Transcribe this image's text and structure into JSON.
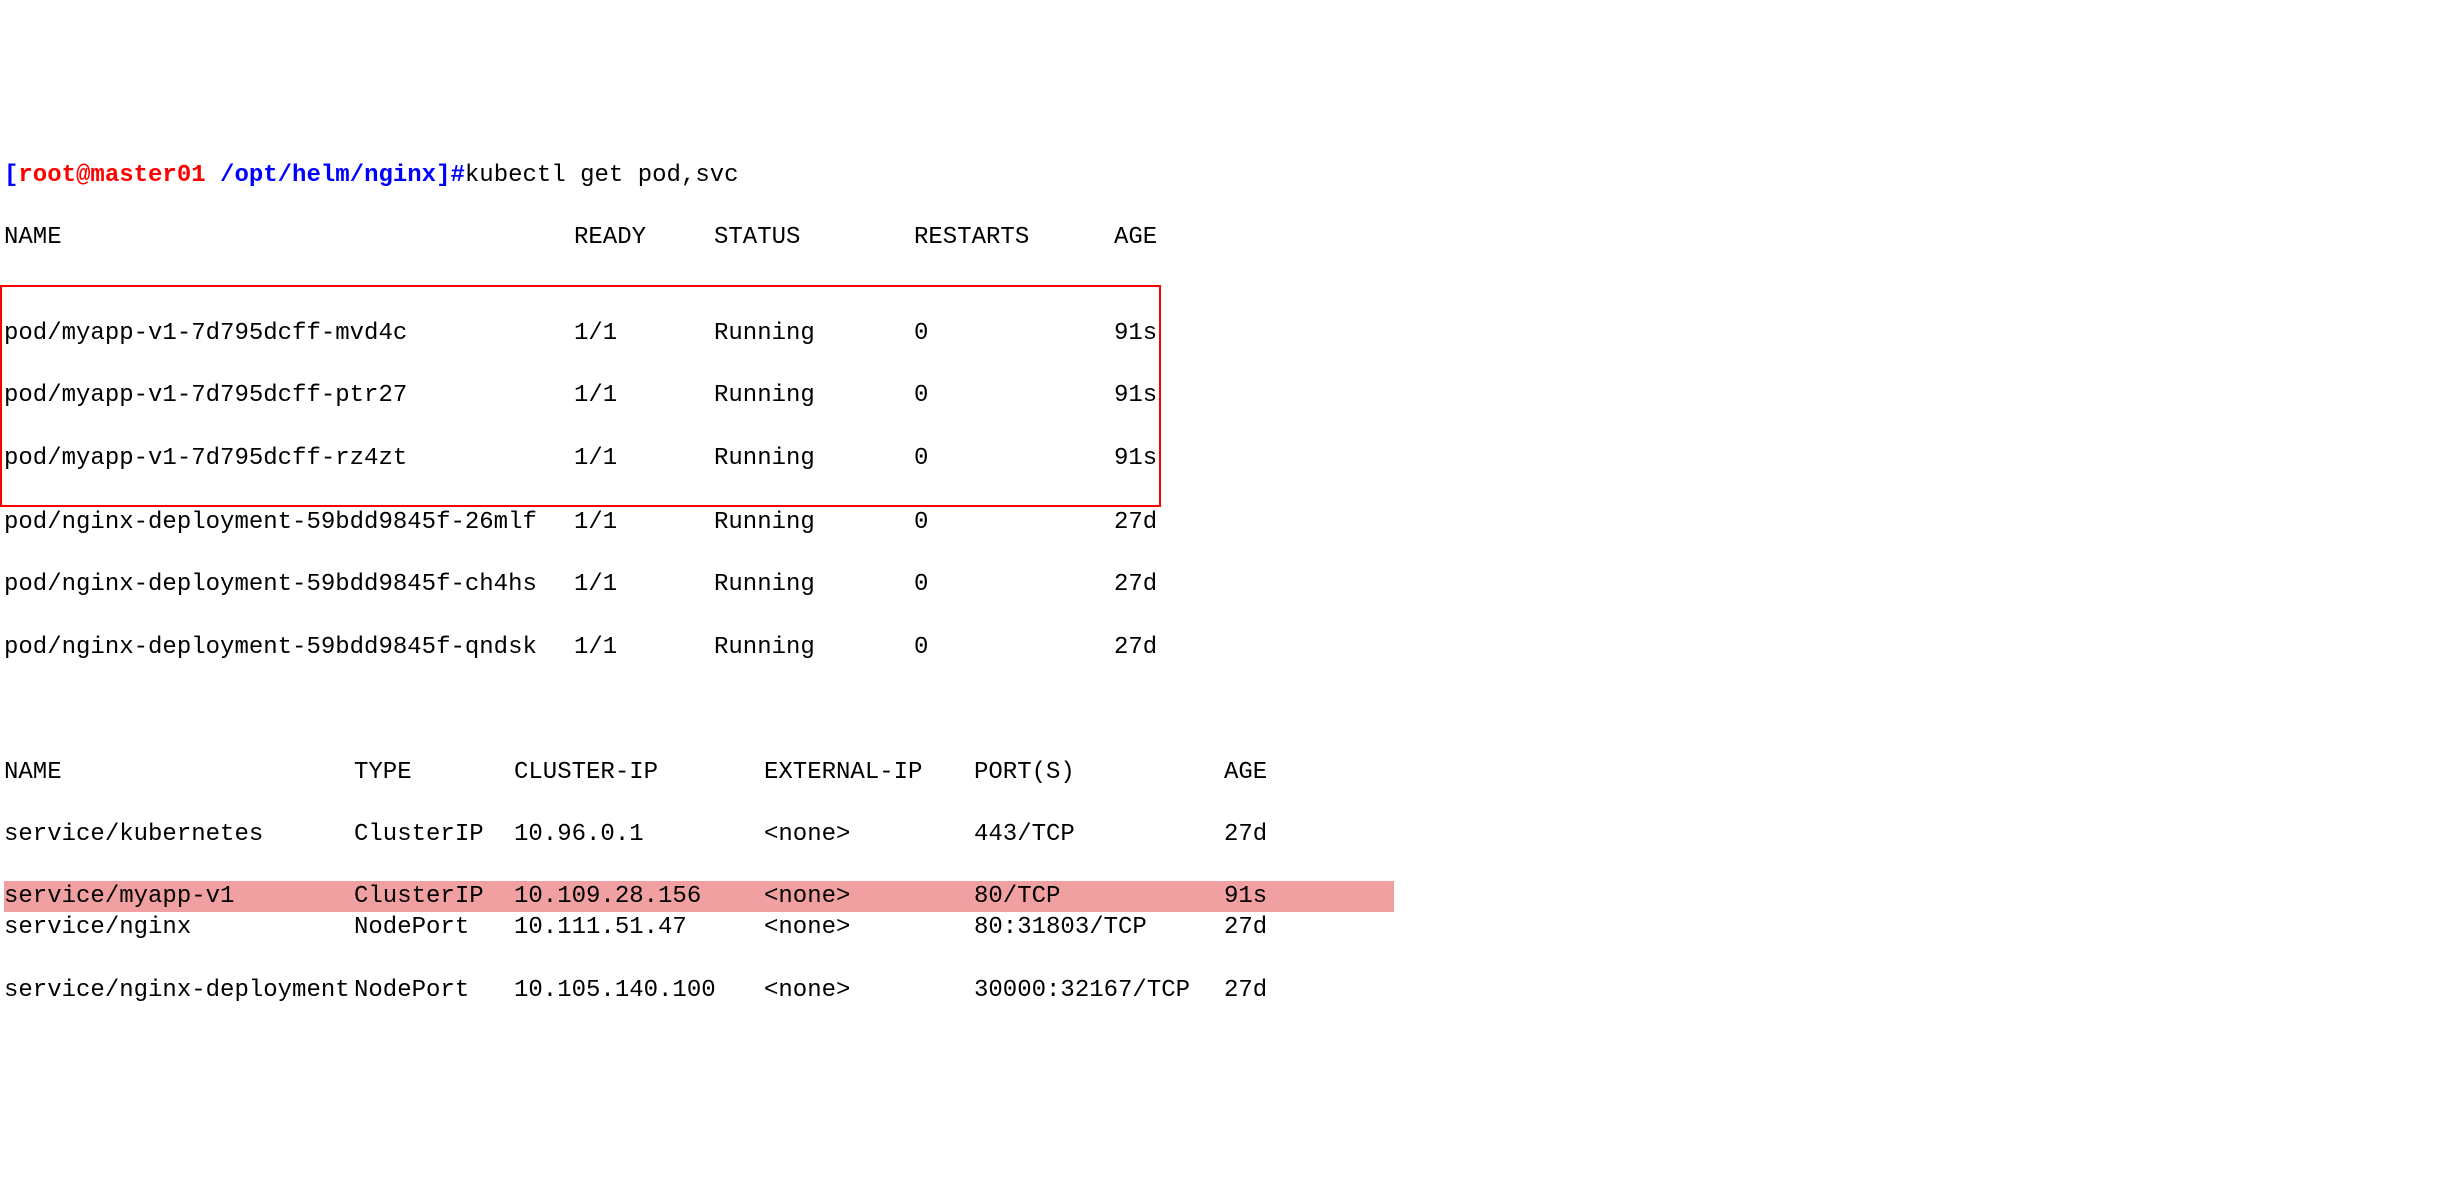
{
  "prompt": {
    "open_bracket": "[",
    "user_host": "root@master01 ",
    "path": "/opt/helm/nginx",
    "close_bracket": "]#",
    "command": "kubectl get pod,svc"
  },
  "pod_header": {
    "name": "NAME",
    "ready": "READY",
    "status": "STATUS",
    "restarts": "RESTARTS",
    "age": "AGE"
  },
  "boxed_pods": [
    {
      "name": "pod/myapp-v1-7d795dcff-mvd4c",
      "ready": "1/1",
      "status": "Running",
      "restarts": "0",
      "age": "91s"
    },
    {
      "name": "pod/myapp-v1-7d795dcff-ptr27",
      "ready": "1/1",
      "status": "Running",
      "restarts": "0",
      "age": "91s"
    },
    {
      "name": "pod/myapp-v1-7d795dcff-rz4zt",
      "ready": "1/1",
      "status": "Running",
      "restarts": "0",
      "age": "91s"
    }
  ],
  "other_pods": [
    {
      "name": "pod/nginx-deployment-59bdd9845f-26mlf",
      "ready": "1/1",
      "status": "Running",
      "restarts": "0",
      "age": "27d"
    },
    {
      "name": "pod/nginx-deployment-59bdd9845f-ch4hs",
      "ready": "1/1",
      "status": "Running",
      "restarts": "0",
      "age": "27d"
    },
    {
      "name": "pod/nginx-deployment-59bdd9845f-qndsk",
      "ready": "1/1",
      "status": "Running",
      "restarts": "0",
      "age": "27d"
    }
  ],
  "svc_header": {
    "name": "NAME",
    "type": "TYPE",
    "cluster_ip": "CLUSTER-IP",
    "external_ip": "EXTERNAL-IP",
    "ports": "PORT(S)",
    "age": "AGE"
  },
  "services_before": [
    {
      "name": "service/kubernetes",
      "type": "ClusterIP",
      "cluster_ip": "10.96.0.1",
      "external_ip": "<none>",
      "ports": "443/TCP",
      "age": "27d"
    }
  ],
  "highlighted_service": {
    "name": "service/myapp-v1",
    "type": "ClusterIP",
    "cluster_ip": "10.109.28.156",
    "external_ip": "<none>",
    "ports": "80/TCP",
    "age": "91s"
  },
  "services_after": [
    {
      "name": "service/nginx",
      "type": "NodePort",
      "cluster_ip": "10.111.51.47",
      "external_ip": "<none>",
      "ports": "80:31803/TCP",
      "age": "27d"
    },
    {
      "name": "service/nginx-deployment",
      "type": "NodePort",
      "cluster_ip": "10.105.140.100",
      "external_ip": "<none>",
      "ports": "30000:32167/TCP",
      "age": "27d"
    }
  ]
}
